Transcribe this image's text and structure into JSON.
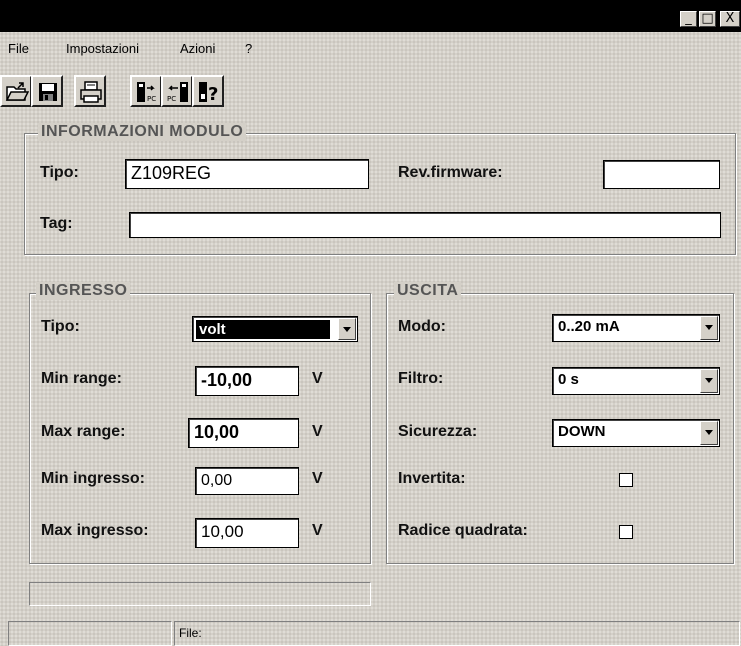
{
  "window": {
    "title": "",
    "controls": {
      "minimize": "_",
      "maximize": "□",
      "close": "X"
    }
  },
  "menu": {
    "file": "File",
    "impostazioni": "Impostazioni",
    "azioni": "Azioni",
    "help": "?"
  },
  "toolbar": {
    "icons": [
      "open-folder-icon",
      "save-icon",
      "print-icon",
      "read-from-module-icon",
      "write-to-module-icon",
      "help-icon"
    ]
  },
  "info": {
    "title": "INFORMAZIONI MODULO",
    "tipo_label": "Tipo:",
    "tipo_value": "Z109REG",
    "rev_label": "Rev.firmware:",
    "rev_value": "",
    "tag_label": "Tag:",
    "tag_value": ""
  },
  "ingresso": {
    "title": "INGRESSO",
    "tipo_label": "Tipo:",
    "tipo_value": "volt",
    "min_range_label": "Min range:",
    "min_range_value": "-10,00",
    "max_range_label": "Max range:",
    "max_range_value": "10,00",
    "min_ingresso_label": "Min ingresso:",
    "min_ingresso_value": "0,00",
    "max_ingresso_label": "Max ingresso:",
    "max_ingresso_value": "10,00",
    "unit": "V"
  },
  "uscita": {
    "title": "USCITA",
    "modo_label": "Modo:",
    "modo_value": "0..20 mA",
    "filtro_label": "Filtro:",
    "filtro_value": "0 s",
    "sicurezza_label": "Sicurezza:",
    "sicurezza_value": "DOWN",
    "invertita_label": "Invertita:",
    "invertita_checked": false,
    "radice_label": "Radice quadrata:",
    "radice_checked": false
  },
  "statusbar": {
    "file_label": "File:"
  }
}
